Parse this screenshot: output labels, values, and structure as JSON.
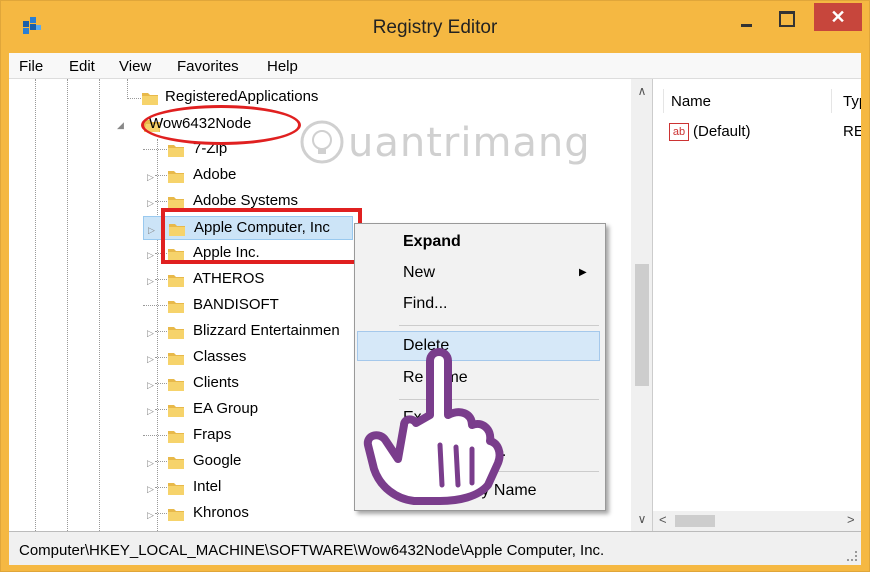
{
  "window": {
    "title": "Registry Editor",
    "close_glyph": "✕"
  },
  "menu": [
    "File",
    "Edit",
    "View",
    "Favorites",
    "Help"
  ],
  "tree": {
    "parent_above": "RegisteredApplications",
    "node": "Wow6432Node",
    "children": [
      "7-Zip",
      "Adobe",
      "Adobe Systems",
      "Apple Computer, Inc",
      "Apple Inc.",
      "ATHEROS",
      "BANDISOFT",
      "Blizzard Entertainmen",
      "Classes",
      "Clients",
      "EA Group",
      "Fraps",
      "Google",
      "Intel",
      "Khronos"
    ]
  },
  "list": {
    "columns": [
      "Name",
      "Typ"
    ],
    "rows": [
      {
        "name": "(Default)",
        "type": "REC",
        "icon": "ab"
      }
    ]
  },
  "context_menu": {
    "expand": "Expand",
    "new": "New",
    "find": "Find...",
    "delete": "Delete",
    "rename_start": "Re",
    "rename_end": "me",
    "export_start": "Ex",
    "permissions_end": "...",
    "copy_start": "Co",
    "copy_end": "y Name"
  },
  "status_bar": {
    "path": "Computer\\HKEY_LOCAL_MACHINE\\SOFTWARE\\Wow6432Node\\Apple Computer, Inc."
  },
  "watermark": {
    "text": "uantrimang"
  },
  "colors": {
    "title_bar": "#f5b842",
    "close_button": "#c7463c",
    "highlight": "#d6e8f8",
    "annotation": "#e02020",
    "hand": "#7a3d8c"
  }
}
